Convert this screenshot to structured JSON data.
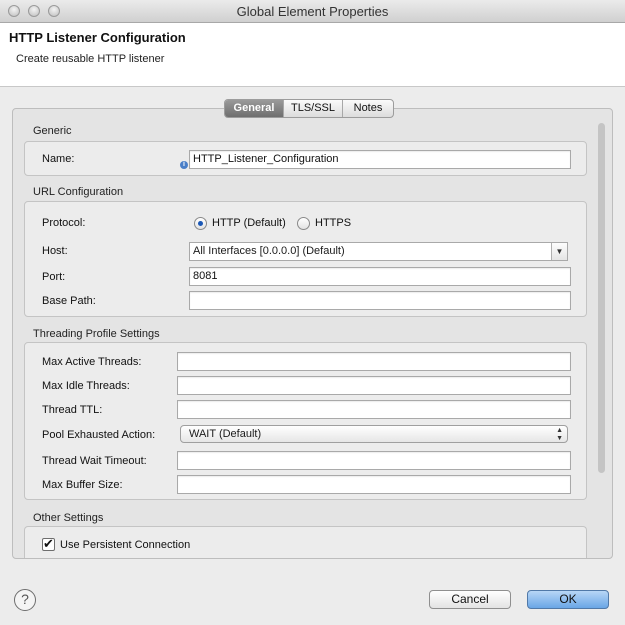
{
  "window": {
    "title": "Global Element Properties"
  },
  "header": {
    "title": "HTTP Listener Configuration",
    "description": "Create reusable HTTP listener"
  },
  "tabs": [
    {
      "label": "General",
      "active": true
    },
    {
      "label": "TLS/SSL",
      "active": false
    },
    {
      "label": "Notes",
      "active": false
    }
  ],
  "generic": {
    "section_label": "Generic",
    "name_label": "Name:",
    "name_value": "HTTP_Listener_Configuration"
  },
  "url_config": {
    "section_label": "URL Configuration",
    "protocol_label": "Protocol:",
    "protocol_options": [
      "HTTP (Default)",
      "HTTPS"
    ],
    "protocol_selected": "HTTP (Default)",
    "host_label": "Host:",
    "host_value": "All Interfaces [0.0.0.0] (Default)",
    "port_label": "Port:",
    "port_value": "8081",
    "base_path_label": "Base Path:",
    "base_path_value": ""
  },
  "threading": {
    "section_label": "Threading Profile Settings",
    "max_active_label": "Max Active Threads:",
    "max_active_value": "",
    "max_idle_label": "Max Idle Threads:",
    "max_idle_value": "",
    "ttl_label": "Thread TTL:",
    "ttl_value": "",
    "pool_action_label": "Pool Exhausted Action:",
    "pool_action_value": "WAIT (Default)",
    "wait_timeout_label": "Thread Wait Timeout:",
    "wait_timeout_value": "",
    "buffer_label": "Max Buffer Size:",
    "buffer_value": ""
  },
  "other": {
    "section_label": "Other Settings",
    "persistent_label": "Use Persistent Connection",
    "persistent_checked": true
  },
  "footer": {
    "help_glyph": "?",
    "cancel_label": "Cancel",
    "ok_label": "OK"
  },
  "colors": {
    "accent": "#1a57b5",
    "primary_button": "#6aa6e6"
  },
  "icons": {
    "info": "info-icon",
    "help": "help-icon",
    "dropdown": "chevron-down-icon"
  }
}
